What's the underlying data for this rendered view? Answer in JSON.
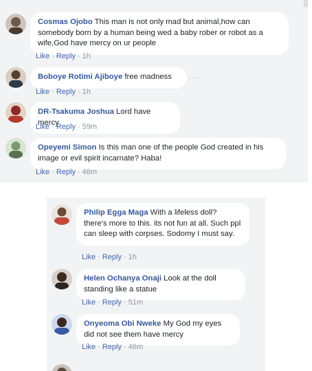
{
  "top_panel": {
    "comments": [
      {
        "author": "Cosmas Ojobo",
        "text": "This man is not only mad but animal,how can somebody born by a human being wed a baby rober or robot as a wife,God have mercy on ur people",
        "like_label": "Like",
        "reply_label": "Reply",
        "time": "1h",
        "avatar_color": "#6e5a4a"
      },
      {
        "author": "Boboye Rotimi Ajiboye",
        "text": "free madness",
        "like_label": "Like",
        "reply_label": "Reply",
        "time": "1h",
        "avatar_color": "#5a4030"
      },
      {
        "author": "DR-Tsakuma Joshua",
        "text": "Lord have mercy",
        "like_label": "Like",
        "reply_label": "Reply",
        "time": "59m",
        "avatar_color": "#8a2a2a"
      },
      {
        "author": "Opeyemi Simon",
        "text": "Is this man one of the people God created in his image or evil spirit incarnate? Haba!",
        "like_label": "Like",
        "reply_label": "Reply",
        "time": "46m",
        "avatar_color": "#7a9a6a"
      }
    ]
  },
  "bottom_panel": {
    "comments": [
      {
        "author": "Philip Egga Maga",
        "text": "With a lifeless doll? there's more to this. its not fun at all. Such ppl can sleep with corpses. Sodomy I must say.",
        "like_label": "Like",
        "reply_label": "Reply",
        "time": "1h",
        "avatar_color": "#c24a3a"
      },
      {
        "author": "Helen Ochanya Onaji",
        "text": "Look at the doll standing like a statue",
        "like_label": "Like",
        "reply_label": "Reply",
        "time": "51m",
        "avatar_color": "#3a2a22"
      },
      {
        "author": "Onyeoma Obi Nweke",
        "text": "My God my eyes did not see them have mercy",
        "like_label": "Like",
        "reply_label": "Reply",
        "time": "46m",
        "avatar_color": "#3a5aa0"
      }
    ]
  },
  "icons": {
    "more": "more-options-icon"
  },
  "colors": {
    "panel_bg": "#f2f3f5",
    "bubble_bg": "#ffffff",
    "author": "#365899",
    "action_link": "#4267b2",
    "meta": "#90949c"
  }
}
